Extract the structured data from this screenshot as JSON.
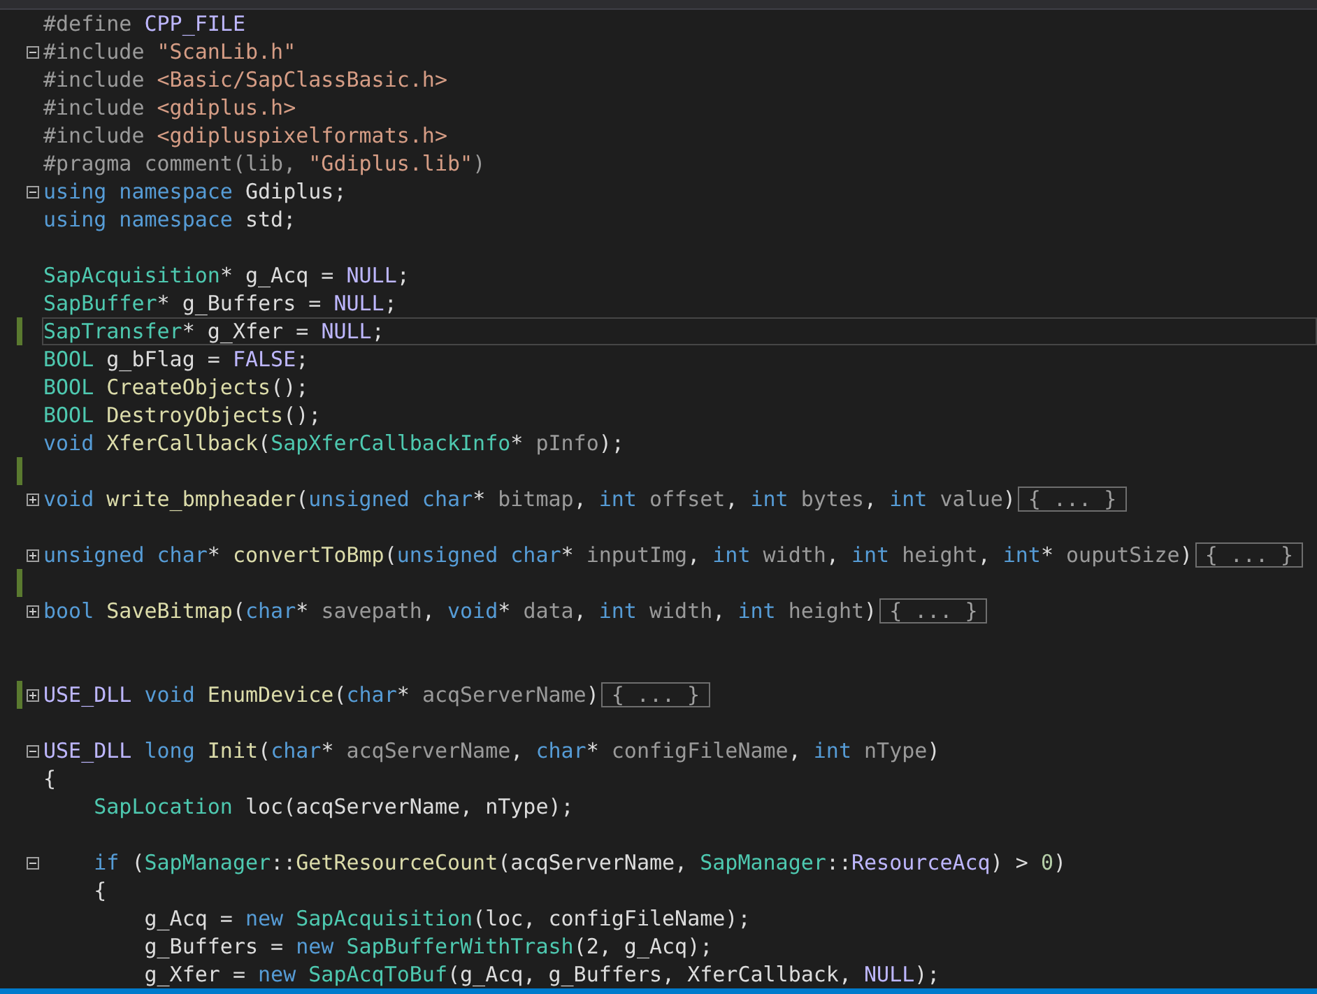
{
  "lines": [
    {
      "tokens": [
        {
          "t": "#define ",
          "kind": "pp"
        },
        {
          "t": "CPP_FILE",
          "kind": "macro"
        }
      ]
    },
    {
      "expanded": true,
      "tokens": [
        {
          "t": "#include ",
          "kind": "pp"
        },
        {
          "t": "\"ScanLib.h\"",
          "kind": "str"
        }
      ]
    },
    {
      "tokens": [
        {
          "t": "#include ",
          "kind": "pp"
        },
        {
          "t": "<Basic/SapClassBasic.h>",
          "kind": "str"
        }
      ]
    },
    {
      "tokens": [
        {
          "t": "#include ",
          "kind": "pp"
        },
        {
          "t": "<gdiplus.h>",
          "kind": "str"
        }
      ]
    },
    {
      "tokens": [
        {
          "t": "#include ",
          "kind": "pp"
        },
        {
          "t": "<gdipluspixelformats.h>",
          "kind": "str"
        }
      ]
    },
    {
      "tokens": [
        {
          "t": "#pragma comment(lib, ",
          "kind": "pp"
        },
        {
          "t": "\"Gdiplus.lib\"",
          "kind": "str"
        },
        {
          "t": ")",
          "kind": "pp"
        }
      ]
    },
    {
      "expanded": true,
      "tokens": [
        {
          "t": "using namespace ",
          "kind": "kw"
        },
        {
          "t": "Gdiplus;",
          "kind": "text"
        }
      ]
    },
    {
      "tokens": [
        {
          "t": "using namespace ",
          "kind": "kw"
        },
        {
          "t": "std;",
          "kind": "text"
        }
      ]
    },
    {
      "changed": false
    },
    {
      "tokens": [
        {
          "t": "SapAcquisition",
          "kind": "type"
        },
        {
          "t": "* g_Acq = ",
          "kind": "text"
        },
        {
          "t": "NULL",
          "kind": "macro"
        },
        {
          "t": ";",
          "kind": "text"
        }
      ]
    },
    {
      "tokens": [
        {
          "t": "SapBuffer",
          "kind": "type"
        },
        {
          "t": "* g_Buffers = ",
          "kind": "text"
        },
        {
          "t": "NULL",
          "kind": "macro"
        },
        {
          "t": ";",
          "kind": "text"
        }
      ]
    },
    {
      "changed": true,
      "current": true,
      "tokens": [
        {
          "t": "SapTransfer",
          "kind": "type"
        },
        {
          "t": "* g_Xfer = ",
          "kind": "text"
        },
        {
          "t": "NULL",
          "kind": "macro"
        },
        {
          "t": ";",
          "kind": "text"
        }
      ]
    },
    {
      "tokens": [
        {
          "t": "BOOL",
          "kind": "type"
        },
        {
          "t": " g_bFlag = ",
          "kind": "text"
        },
        {
          "t": "FALSE",
          "kind": "macro"
        },
        {
          "t": ";",
          "kind": "text"
        }
      ]
    },
    {
      "tokens": [
        {
          "t": "BOOL ",
          "kind": "type"
        },
        {
          "t": "CreateObjects",
          "kind": "fn"
        },
        {
          "t": "();",
          "kind": "text"
        }
      ]
    },
    {
      "tokens": [
        {
          "t": "BOOL ",
          "kind": "type"
        },
        {
          "t": "DestroyObjects",
          "kind": "fn"
        },
        {
          "t": "();",
          "kind": "text"
        }
      ]
    },
    {
      "tokens": [
        {
          "t": "void ",
          "kind": "kw"
        },
        {
          "t": "XferCallback",
          "kind": "fn"
        },
        {
          "t": "(",
          "kind": "text"
        },
        {
          "t": "SapXferCallbackInfo",
          "kind": "type"
        },
        {
          "t": "* ",
          "kind": "text"
        },
        {
          "t": "pInfo",
          "kind": "param"
        },
        {
          "t": ");",
          "kind": "text"
        }
      ]
    },
    {
      "changed": true
    },
    {
      "expanded": false,
      "collapsed": "{ ... }",
      "tokens": [
        {
          "t": "void ",
          "kind": "kw"
        },
        {
          "t": "write_bmpheader",
          "kind": "fn"
        },
        {
          "t": "(",
          "kind": "text"
        },
        {
          "t": "unsigned char",
          "kind": "kw"
        },
        {
          "t": "* ",
          "kind": "text"
        },
        {
          "t": "bitmap",
          "kind": "param"
        },
        {
          "t": ", ",
          "kind": "text"
        },
        {
          "t": "int ",
          "kind": "kw"
        },
        {
          "t": "offset",
          "kind": "param"
        },
        {
          "t": ", ",
          "kind": "text"
        },
        {
          "t": "int ",
          "kind": "kw"
        },
        {
          "t": "bytes",
          "kind": "param"
        },
        {
          "t": ", ",
          "kind": "text"
        },
        {
          "t": "int ",
          "kind": "kw"
        },
        {
          "t": "value",
          "kind": "param"
        },
        {
          "t": ")",
          "kind": "text"
        }
      ]
    },
    {
      "changed": false
    },
    {
      "expanded": false,
      "collapsed": "{ ... }",
      "tokens": [
        {
          "t": "unsigned char",
          "kind": "kw"
        },
        {
          "t": "* ",
          "kind": "text"
        },
        {
          "t": "convertToBmp",
          "kind": "fn"
        },
        {
          "t": "(",
          "kind": "text"
        },
        {
          "t": "unsigned char",
          "kind": "kw"
        },
        {
          "t": "* ",
          "kind": "text"
        },
        {
          "t": "inputImg",
          "kind": "param"
        },
        {
          "t": ", ",
          "kind": "text"
        },
        {
          "t": "int ",
          "kind": "kw"
        },
        {
          "t": "width",
          "kind": "param"
        },
        {
          "t": ", ",
          "kind": "text"
        },
        {
          "t": "int ",
          "kind": "kw"
        },
        {
          "t": "height",
          "kind": "param"
        },
        {
          "t": ", ",
          "kind": "text"
        },
        {
          "t": "int",
          "kind": "kw"
        },
        {
          "t": "* ",
          "kind": "text"
        },
        {
          "t": "ouputSize",
          "kind": "param"
        },
        {
          "t": ")",
          "kind": "text"
        }
      ]
    },
    {
      "changed": true
    },
    {
      "expanded": false,
      "collapsed": "{ ... }",
      "tokens": [
        {
          "t": "bool ",
          "kind": "kw"
        },
        {
          "t": "SaveBitmap",
          "kind": "fn"
        },
        {
          "t": "(",
          "kind": "text"
        },
        {
          "t": "char",
          "kind": "kw"
        },
        {
          "t": "* ",
          "kind": "text"
        },
        {
          "t": "savepath",
          "kind": "param"
        },
        {
          "t": ", ",
          "kind": "text"
        },
        {
          "t": "void",
          "kind": "kw"
        },
        {
          "t": "* ",
          "kind": "text"
        },
        {
          "t": "data",
          "kind": "param"
        },
        {
          "t": ", ",
          "kind": "text"
        },
        {
          "t": "int ",
          "kind": "kw"
        },
        {
          "t": "width",
          "kind": "param"
        },
        {
          "t": ", ",
          "kind": "text"
        },
        {
          "t": "int ",
          "kind": "kw"
        },
        {
          "t": "height",
          "kind": "param"
        },
        {
          "t": ")",
          "kind": "text"
        }
      ]
    },
    {
      "changed": false
    },
    {
      "changed": false
    },
    {
      "changed": true,
      "expanded": false,
      "collapsed": "{ ... }",
      "tokens": [
        {
          "t": "USE_DLL ",
          "kind": "macro"
        },
        {
          "t": "void ",
          "kind": "kw"
        },
        {
          "t": "EnumDevice",
          "kind": "fn"
        },
        {
          "t": "(",
          "kind": "text"
        },
        {
          "t": "char",
          "kind": "kw"
        },
        {
          "t": "* ",
          "kind": "text"
        },
        {
          "t": "acqServerName",
          "kind": "param"
        },
        {
          "t": ")",
          "kind": "text"
        }
      ]
    },
    {
      "changed": false
    },
    {
      "expanded": true,
      "tokens": [
        {
          "t": "USE_DLL ",
          "kind": "macro"
        },
        {
          "t": "long ",
          "kind": "kw"
        },
        {
          "t": "Init",
          "kind": "fn"
        },
        {
          "t": "(",
          "kind": "text"
        },
        {
          "t": "char",
          "kind": "kw"
        },
        {
          "t": "* ",
          "kind": "text"
        },
        {
          "t": "acqServerName",
          "kind": "param"
        },
        {
          "t": ", ",
          "kind": "text"
        },
        {
          "t": "char",
          "kind": "kw"
        },
        {
          "t": "* ",
          "kind": "text"
        },
        {
          "t": "configFileName",
          "kind": "param"
        },
        {
          "t": ", ",
          "kind": "text"
        },
        {
          "t": "int ",
          "kind": "kw"
        },
        {
          "t": "nType",
          "kind": "param"
        },
        {
          "t": ")",
          "kind": "text"
        }
      ]
    },
    {
      "tokens": [
        {
          "t": "{",
          "kind": "text"
        }
      ]
    },
    {
      "tokens": [
        {
          "t": "    SapLocation ",
          "kind": "type"
        },
        {
          "t": "loc(acqServerName, nType);",
          "kind": "text"
        }
      ]
    },
    {
      "changed": false
    },
    {
      "expanded": true,
      "tokens": [
        {
          "t": "    if ",
          "kind": "kw"
        },
        {
          "t": "(",
          "kind": "text"
        },
        {
          "t": "SapManager",
          "kind": "type"
        },
        {
          "t": "::",
          "kind": "text"
        },
        {
          "t": "GetResourceCount",
          "kind": "fn"
        },
        {
          "t": "(acqServerName, ",
          "kind": "text"
        },
        {
          "t": "SapManager",
          "kind": "type"
        },
        {
          "t": "::",
          "kind": "text"
        },
        {
          "t": "ResourceAcq",
          "kind": "macro"
        },
        {
          "t": ") > ",
          "kind": "text"
        },
        {
          "t": "0",
          "kind": "num"
        },
        {
          "t": ")",
          "kind": "text"
        }
      ]
    },
    {
      "tokens": [
        {
          "t": "    {",
          "kind": "text"
        }
      ]
    },
    {
      "tokens": [
        {
          "t": "        g_Acq = ",
          "kind": "text"
        },
        {
          "t": "new ",
          "kind": "kw"
        },
        {
          "t": "SapAcquisition",
          "kind": "type"
        },
        {
          "t": "(loc, configFileName);",
          "kind": "text"
        }
      ]
    },
    {
      "tokens": [
        {
          "t": "        g_Buffers = ",
          "kind": "text"
        },
        {
          "t": "new ",
          "kind": "kw"
        },
        {
          "t": "SapBufferWithTrash",
          "kind": "type"
        },
        {
          "t": "(2, g_Acq);",
          "kind": "text"
        }
      ]
    },
    {
      "tokens": [
        {
          "t": "        g_Xfer = ",
          "kind": "text"
        },
        {
          "t": "new ",
          "kind": "kw"
        },
        {
          "t": "SapAcqToBuf",
          "kind": "type"
        },
        {
          "t": "(g_Acq, g_Buffers, XferCallback, ",
          "kind": "text"
        },
        {
          "t": "NULL",
          "kind": "macro"
        },
        {
          "t": ");",
          "kind": "text"
        }
      ]
    }
  ]
}
